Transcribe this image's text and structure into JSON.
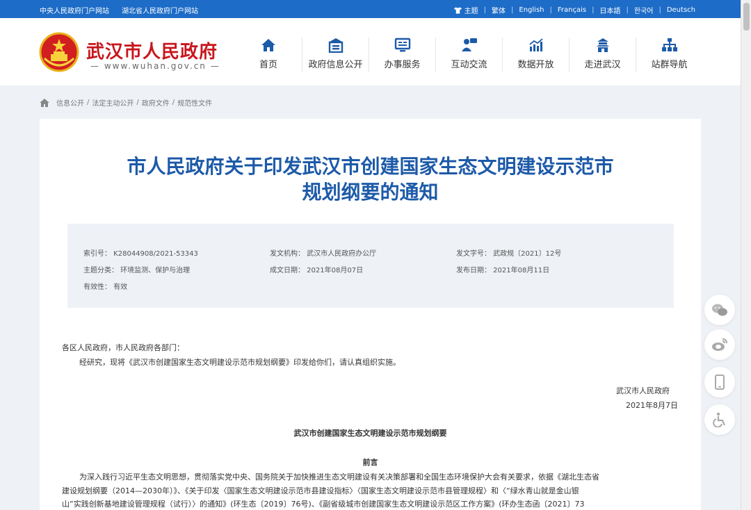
{
  "topbar": {
    "links_left": [
      "中央人民政府门户网站",
      "湖北省人民政府门户网站"
    ],
    "theme_label": "主题",
    "languages": [
      "繁体",
      "English",
      "Français",
      "日本語",
      "한국어",
      "Deutsch"
    ]
  },
  "site": {
    "title": "武汉市人民政府",
    "url": "— www.wuhan.gov.cn —"
  },
  "nav": [
    {
      "label": "首页",
      "icon": "home-icon"
    },
    {
      "label": "政府信息公开",
      "icon": "info-disclosure-icon"
    },
    {
      "label": "办事服务",
      "icon": "monitor-icon"
    },
    {
      "label": "互动交流",
      "icon": "chat-icon"
    },
    {
      "label": "数据开放",
      "icon": "bar-chart-icon"
    },
    {
      "label": "走进武汉",
      "icon": "tower-icon"
    },
    {
      "label": "站群导航",
      "icon": "sitemap-icon"
    }
  ],
  "breadcrumb": [
    "信息公开",
    "法定主动公开",
    "政府文件",
    "规范性文件"
  ],
  "document": {
    "title_line1": "市人民政府关于印发武汉市创建国家生态文明建设示范市",
    "title_line2": "规划纲要的通知",
    "meta": {
      "index_no": "索引号：  K28044908/2021-53343",
      "issuer": "发文机构：  武汉市人民政府办公厅",
      "doc_no": "发文字号：  武政规〔2021〕12号",
      "category": "主题分类：  环境监测、保护与治理",
      "created": "成文日期：  2021年08月07日",
      "published": "发布日期：  2021年08月11日",
      "validity": "有效性：  有效"
    },
    "salutation": "各区人民政府，市人民政府各部门：",
    "paragraph1": "经研究，现将《武汉市创建国家生态文明建设示范市规划纲要》印发给你们，请认真组织实施。",
    "signature_org": "武汉市人民政府",
    "signature_date": "2021年8月7日",
    "section_title": "武汉市创建国家生态文明建设示范市规划纲要",
    "preface_title": "前言",
    "preface_line1": "为深入践行习近平生态文明思想，贯彻落实党中央、国务院关于加快推进生态文明建设有关决策部署和全国生态环境保护大会有关要求，依据《湖北生态省",
    "preface_line2": "建设规划纲要（2014—2030年）》、《关于印发〈国家生态文明建设示范市县建设指标〉〈国家生态文明建设示范市县管理规程〉和〈“绿水青山就是金山银",
    "preface_line3": "山”实践创新基地建设管理规程（试行）〉的通知》(环生态〔2019〕76号)、《副省级城市创建国家生态文明建设示范区工作方案》(环办生态函〔2021〕73"
  },
  "share": [
    "wechat-icon",
    "weibo-icon",
    "mobile-icon",
    "accessibility-icon"
  ],
  "colors": {
    "topbar": "#1d6cc7",
    "title_blue": "#1d5aa8",
    "site_red": "#c8161d",
    "page_bg": "#eef1f6"
  }
}
